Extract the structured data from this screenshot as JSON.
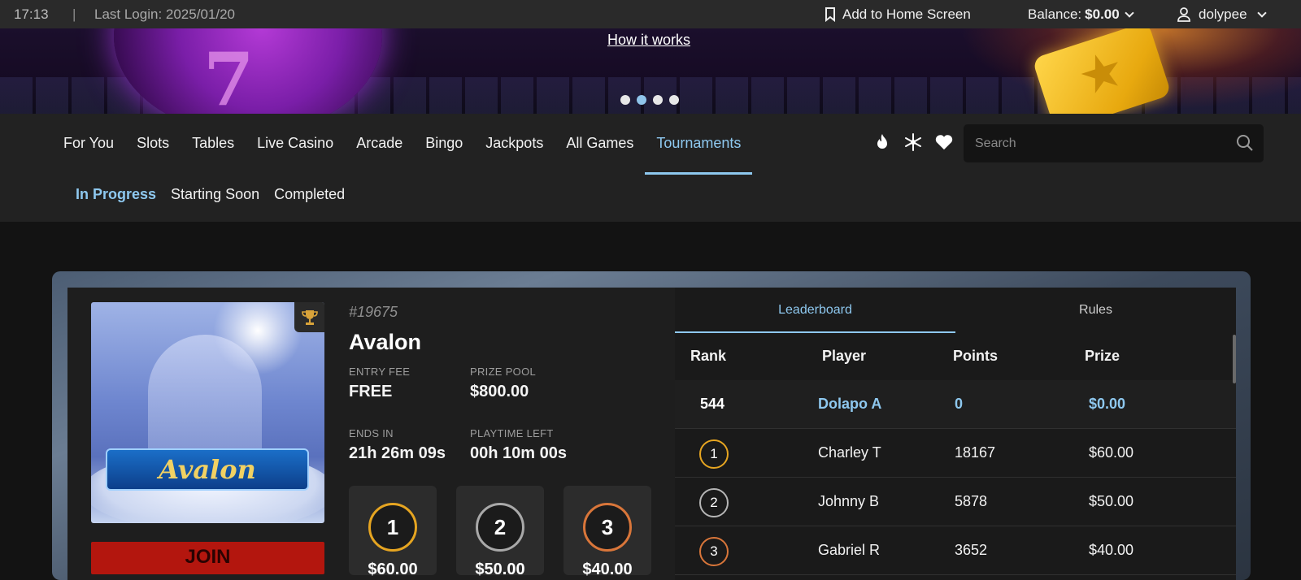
{
  "topbar": {
    "time": "17:13",
    "separator": "|",
    "last_login": "Last Login: 2025/01/20",
    "add_home": "Add to Home Screen",
    "balance_label": "Balance:",
    "balance_value": "$0.00",
    "username": "dolypee"
  },
  "banner": {
    "how_it_works": "How it works",
    "slides": 4,
    "active_slide": 2
  },
  "nav": {
    "tabs": [
      {
        "label": "For You"
      },
      {
        "label": "Slots"
      },
      {
        "label": "Tables"
      },
      {
        "label": "Live Casino"
      },
      {
        "label": "Arcade"
      },
      {
        "label": "Bingo"
      },
      {
        "label": "Jackpots"
      },
      {
        "label": "All Games"
      },
      {
        "label": "Tournaments",
        "active": true
      }
    ],
    "icons": [
      "fire-icon",
      "snowflake-icon",
      "heart-icon"
    ],
    "search_placeholder": "Search",
    "subtabs": [
      {
        "label": "In Progress",
        "active": true
      },
      {
        "label": "Starting Soon"
      },
      {
        "label": "Completed"
      }
    ]
  },
  "tournament": {
    "id": "#19675",
    "name": "Avalon",
    "logo_text": "Avalon",
    "entry_fee_label": "ENTRY FEE",
    "entry_fee": "FREE",
    "prize_pool_label": "PRIZE POOL",
    "prize_pool": "$800.00",
    "ends_in_label": "ENDS IN",
    "ends_in": "21h 26m 09s",
    "playtime_label": "PLAYTIME LEFT",
    "playtime": "00h 10m 00s",
    "join_label": "JOIN",
    "podium": [
      {
        "place": "1",
        "prize": "$60.00",
        "color": "#e6a521"
      },
      {
        "place": "2",
        "prize": "$50.00",
        "color": "#a9a9a9"
      },
      {
        "place": "3",
        "prize": "$40.00",
        "color": "#d9763a"
      }
    ]
  },
  "leaderboard": {
    "tabs": [
      {
        "label": "Leaderboard",
        "active": true
      },
      {
        "label": "Rules"
      }
    ],
    "headers": {
      "rank": "Rank",
      "player": "Player",
      "points": "Points",
      "prize": "Prize"
    },
    "me": {
      "rank": "544",
      "player": "Dolapo A",
      "points": "0",
      "prize": "$0.00"
    },
    "rows": [
      {
        "rank": "1",
        "player": "Charley T",
        "points": "18167",
        "prize": "$60.00",
        "color": "#e6a521"
      },
      {
        "rank": "2",
        "player": "Johnny B",
        "points": "5878",
        "prize": "$50.00",
        "color": "#b5b5b5"
      },
      {
        "rank": "3",
        "player": "Gabriel R",
        "points": "3652",
        "prize": "$40.00",
        "color": "#d9763a"
      }
    ]
  },
  "colors": {
    "accent": "#8ec8ef",
    "join": "#b3160e"
  }
}
